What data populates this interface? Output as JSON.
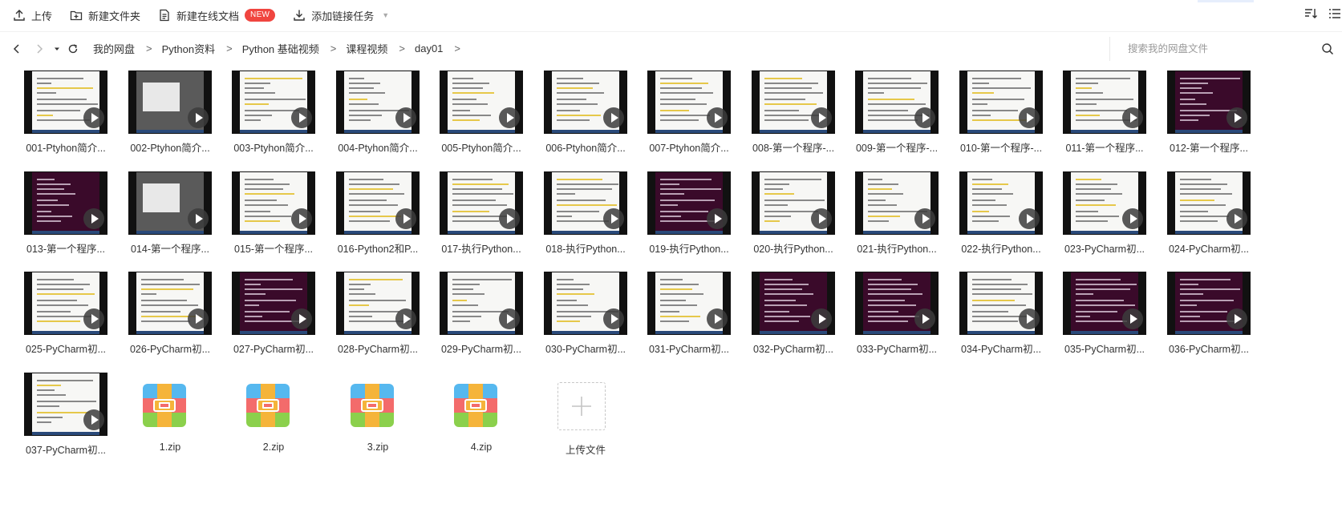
{
  "toolbar": {
    "upload_label": "上传",
    "new_folder_label": "新建文件夹",
    "new_doc_label": "新建在线文档",
    "new_badge": "NEW",
    "add_link_label": "添加链接任务"
  },
  "breadcrumb": [
    "我的网盘",
    "Python资料",
    "Python 基础视频",
    "课程视频",
    "day01"
  ],
  "search": {
    "placeholder": "搜索我的网盘文件"
  },
  "files": [
    {
      "name": "001-Ptyhon简介...",
      "kind": "video",
      "theme": "light"
    },
    {
      "name": "002-Ptyhon简介...",
      "kind": "video",
      "theme": "gray"
    },
    {
      "name": "003-Ptyhon简介...",
      "kind": "video",
      "theme": "light"
    },
    {
      "name": "004-Ptyhon简介...",
      "kind": "video",
      "theme": "light"
    },
    {
      "name": "005-Ptyhon简介...",
      "kind": "video",
      "theme": "light"
    },
    {
      "name": "006-Ptyhon简介...",
      "kind": "video",
      "theme": "light"
    },
    {
      "name": "007-Ptyhon简介...",
      "kind": "video",
      "theme": "light"
    },
    {
      "name": "008-第一个程序-...",
      "kind": "video",
      "theme": "light"
    },
    {
      "name": "009-第一个程序-...",
      "kind": "video",
      "theme": "light"
    },
    {
      "name": "010-第一个程序-...",
      "kind": "video",
      "theme": "light"
    },
    {
      "name": "011-第一个程序...",
      "kind": "video",
      "theme": "light"
    },
    {
      "name": "012-第一个程序...",
      "kind": "video",
      "theme": "dark"
    },
    {
      "name": "013-第一个程序...",
      "kind": "video",
      "theme": "dark"
    },
    {
      "name": "014-第一个程序...",
      "kind": "video",
      "theme": "gray"
    },
    {
      "name": "015-第一个程序...",
      "kind": "video",
      "theme": "light"
    },
    {
      "name": "016-Python2和P...",
      "kind": "video",
      "theme": "light"
    },
    {
      "name": "017-执行Python...",
      "kind": "video",
      "theme": "light"
    },
    {
      "name": "018-执行Python...",
      "kind": "video",
      "theme": "light"
    },
    {
      "name": "019-执行Python...",
      "kind": "video",
      "theme": "dark"
    },
    {
      "name": "020-执行Python...",
      "kind": "video",
      "theme": "light"
    },
    {
      "name": "021-执行Python...",
      "kind": "video",
      "theme": "light"
    },
    {
      "name": "022-执行Python...",
      "kind": "video",
      "theme": "light"
    },
    {
      "name": "023-PyCharm初...",
      "kind": "video",
      "theme": "light"
    },
    {
      "name": "024-PyCharm初...",
      "kind": "video",
      "theme": "light"
    },
    {
      "name": "025-PyCharm初...",
      "kind": "video",
      "theme": "light"
    },
    {
      "name": "026-PyCharm初...",
      "kind": "video",
      "theme": "light"
    },
    {
      "name": "027-PyCharm初...",
      "kind": "video",
      "theme": "dark"
    },
    {
      "name": "028-PyCharm初...",
      "kind": "video",
      "theme": "light"
    },
    {
      "name": "029-PyCharm初...",
      "kind": "video",
      "theme": "light"
    },
    {
      "name": "030-PyCharm初...",
      "kind": "video",
      "theme": "light"
    },
    {
      "name": "031-PyCharm初...",
      "kind": "video",
      "theme": "light"
    },
    {
      "name": "032-PyCharm初...",
      "kind": "video",
      "theme": "dark"
    },
    {
      "name": "033-PyCharm初...",
      "kind": "video",
      "theme": "dark"
    },
    {
      "name": "034-PyCharm初...",
      "kind": "video",
      "theme": "light"
    },
    {
      "name": "035-PyCharm初...",
      "kind": "video",
      "theme": "dark"
    },
    {
      "name": "036-PyCharm初...",
      "kind": "video",
      "theme": "dark"
    },
    {
      "name": "037-PyCharm初...",
      "kind": "video",
      "theme": "light"
    },
    {
      "name": "1.zip",
      "kind": "zip"
    },
    {
      "name": "2.zip",
      "kind": "zip"
    },
    {
      "name": "3.zip",
      "kind": "zip"
    },
    {
      "name": "4.zip",
      "kind": "zip"
    },
    {
      "name": "上传文件",
      "kind": "upload"
    }
  ],
  "colors": {
    "badge": "#f0453f",
    "zip_top": "#56b8ef",
    "zip_mid": "#f36b6b",
    "zip_bottom": "#8bd04c",
    "zip_strap": "#f5b43a"
  },
  "icons": {
    "upload": "upload-icon",
    "new_folder": "folder-plus-icon",
    "new_doc": "document-icon",
    "add_link": "download-icon",
    "back": "chevron-left-icon",
    "forward": "chevron-right-icon",
    "history": "caret-down-icon",
    "refresh": "refresh-icon",
    "search": "search-icon",
    "sort": "sort-icon",
    "view": "list-view-icon"
  }
}
